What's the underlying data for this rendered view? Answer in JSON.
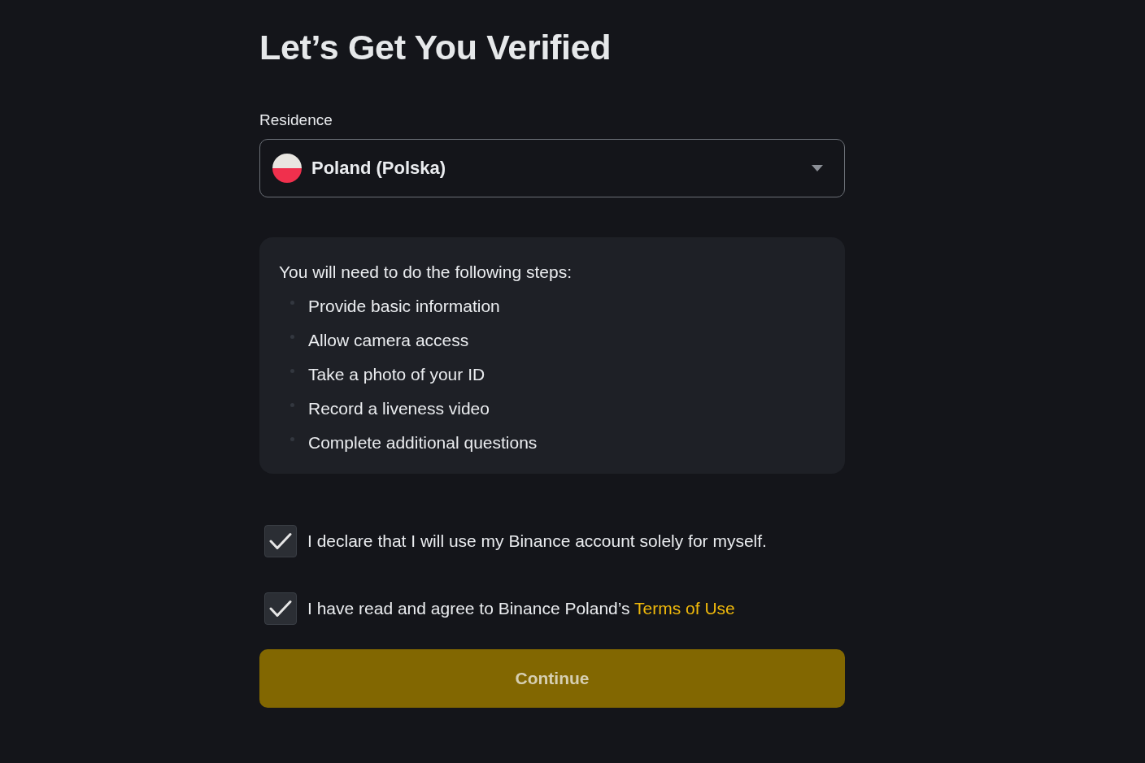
{
  "page": {
    "title": "Let’s Get You Verified"
  },
  "residence": {
    "label": "Residence",
    "value": "Poland (Polska)"
  },
  "steps": {
    "intro": "You will need to do the following steps:",
    "items": [
      "Provide basic information",
      "Allow camera access",
      "Take a photo of your ID",
      "Record a liveness video",
      "Complete additional questions"
    ]
  },
  "agreements": [
    {
      "text": "I declare that I will use my Binance account solely for myself.",
      "checked": true
    },
    {
      "text": "I have read and agree to Binance Poland’s ",
      "link": "Terms of Use",
      "checked": true
    }
  ],
  "continue_button": {
    "label": "Continue"
  }
}
